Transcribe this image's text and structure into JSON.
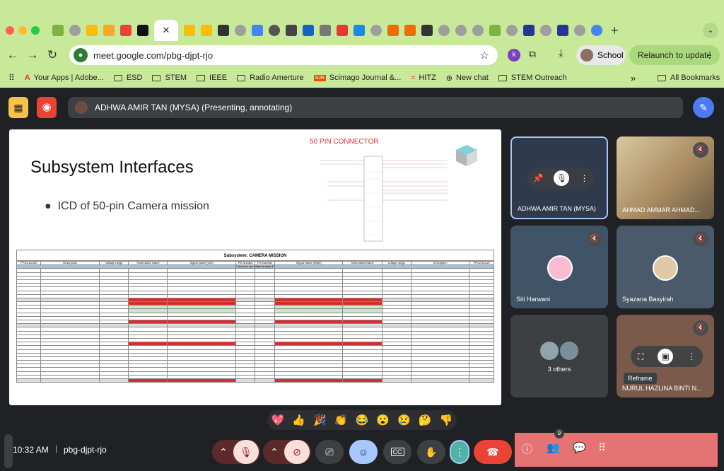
{
  "browser": {
    "url": "meet.google.com/pbg-djpt-rjo",
    "profile_label": "School",
    "relaunch_label": "Relaunch to update",
    "bookmarks": [
      {
        "label": "Your Apps | Adobe..."
      },
      {
        "label": "ESD"
      },
      {
        "label": "STEM"
      },
      {
        "label": "IEEE"
      },
      {
        "label": "Radio Amerture"
      },
      {
        "label": "Scimago Journal &..."
      },
      {
        "label": "HITZ"
      },
      {
        "label": "New chat"
      },
      {
        "label": "STEM Outreach"
      }
    ],
    "all_bookmarks_label": "All Bookmarks"
  },
  "meet": {
    "presenting_text": "ADHWA AMIR TAN (MYSA) (Presenting, annotating)",
    "slide": {
      "title": "Subsystem Interfaces",
      "bullet": "ICD of 50-pin Camera mission",
      "connector_title": "50 PIN CONNECTOR",
      "table_title": "Subsystem: CAMERA MISSION",
      "headers": [
        "FPGA ALIAS",
        "Description",
        "voltage range",
        "Schematics Name",
        "Signal Name (Left)",
        "Pin Number",
        "Pin Number",
        "Signal Name (Right)",
        "Schematics Name",
        "voltage range",
        "Description",
        "FPGA ALIAS"
      ],
      "connector_note": "Connector pin (Male-female) F1"
    },
    "participants": [
      {
        "name": "ADHWA AMIR TAN (MYSA)"
      },
      {
        "name": "AHMAD AMMAR AHMAD..."
      },
      {
        "name": "Siti Harwani"
      },
      {
        "name": "Syazana Basyirah"
      },
      {
        "name": "3 others"
      },
      {
        "name": "NURUL HAZLINA BINTI N..."
      }
    ],
    "reframe_tooltip": "Reframe",
    "time": "10:32 AM",
    "meeting_code": "pbg-djpt-rjo",
    "participant_count": "9",
    "reactions": [
      "💖",
      "👍",
      "🎉",
      "👏",
      "😂",
      "😮",
      "😢",
      "🤔",
      "👎"
    ]
  },
  "colors": {
    "chrome": "#c8e89a",
    "meet_bg": "#202124",
    "end_call": "#ea4335",
    "side_panel": "#e57373"
  }
}
